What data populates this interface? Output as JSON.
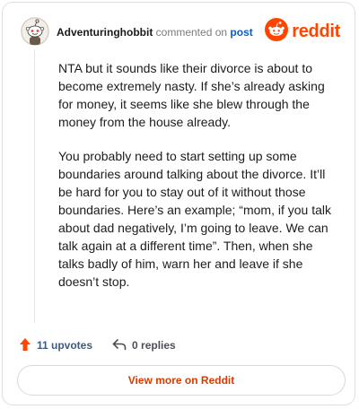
{
  "comment": {
    "username": "Adventuringhobbit",
    "action_text": "commented on",
    "post_link_text": "post",
    "avatar_icon": "snoo-avatar-icon",
    "paragraphs": [
      "NTA but it sounds like their divorce is about to become extremely nasty. If she’s already asking for money, it seems like she blew through the money from the house already.",
      "You probably need to start setting up some boundaries around talking about the divorce. It’ll be hard for you to stay out of it without those boundaries. Here’s an example; “mom, if you talk about dad negatively, I’m going to leave. We can talk again at a different time”. Then, when she talks badly of him, warn her and leave if she doesn’t stop."
    ]
  },
  "brand": {
    "name": "reddit",
    "icon": "reddit-logo-icon",
    "color": "#ff4500"
  },
  "footer": {
    "upvotes_label": "11 upvotes",
    "upvote_icon": "upvote-arrow-icon",
    "replies_label": "0 replies",
    "reply_icon": "reply-arrow-icon"
  },
  "cta": {
    "label": "View more on Reddit"
  },
  "colors": {
    "accent": "#ff4500",
    "link": "#0a5ec6",
    "cta_text": "#d93a00"
  }
}
